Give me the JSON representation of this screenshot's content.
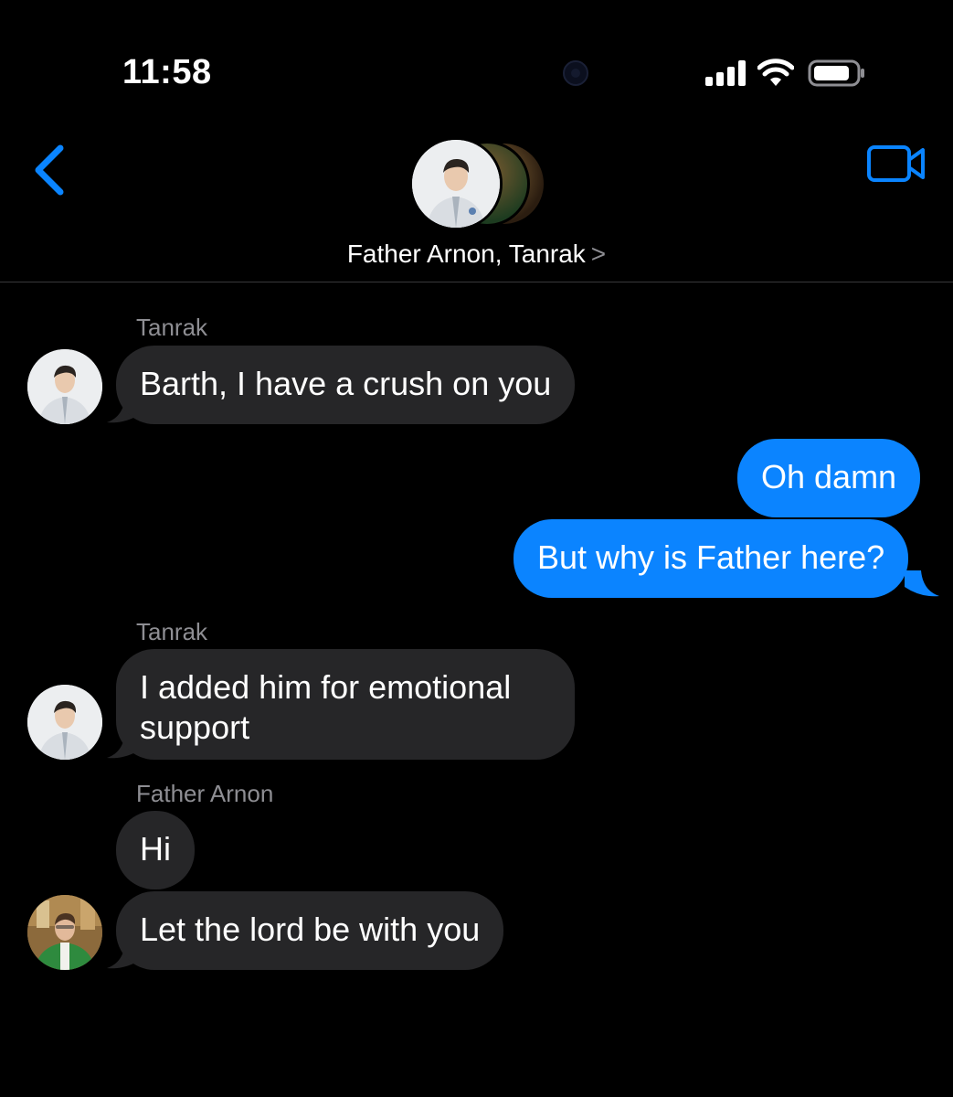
{
  "status_bar": {
    "time": "11:58",
    "icons": [
      "cellular-signal-icon",
      "wifi-icon",
      "battery-icon"
    ]
  },
  "header": {
    "title": "Father Arnon, Tanrak",
    "chevron": ">",
    "icons": [
      "back-chevron-icon",
      "video-camera-icon"
    ]
  },
  "messages": [
    {
      "sender": "Tanrak",
      "text": "Barth, I have a crush on you",
      "direction": "incoming"
    },
    {
      "text": "Oh damn",
      "direction": "outgoing"
    },
    {
      "text": "But why is Father here?",
      "direction": "outgoing"
    },
    {
      "sender": "Tanrak",
      "text_line1": "I added him for emotional",
      "text_line2": "support",
      "direction": "incoming"
    },
    {
      "sender": "Father Arnon",
      "text": "Hi",
      "direction": "incoming"
    },
    {
      "text": "Let the lord be with you",
      "direction": "incoming"
    }
  ],
  "colors": {
    "background": "#000000",
    "incoming_bubble": "#262628",
    "outgoing_bubble": "#0b84ff",
    "accent": "#0a84ff",
    "secondary_text": "#8e8e93"
  }
}
